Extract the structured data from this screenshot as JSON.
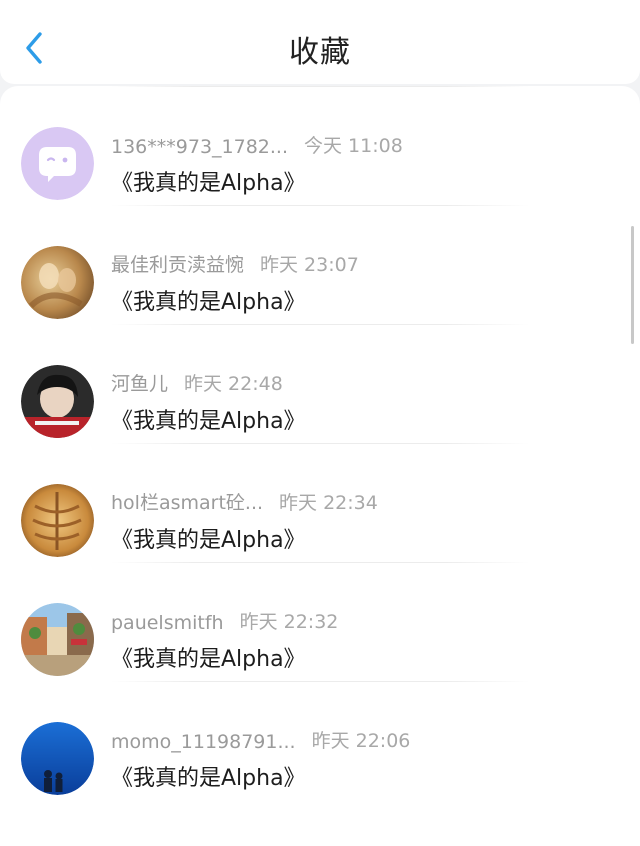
{
  "header": {
    "title": "收藏",
    "back_icon": "chevron-left-icon",
    "accent": "#2d9ce8"
  },
  "items": [
    {
      "name": "136***973_1782...",
      "time": "今天 11:08",
      "content": "《我真的是Alpha》",
      "avatar": "chat-bubble-avatar"
    },
    {
      "name": "最佳利贡渎益惋",
      "time": "昨天 23:07",
      "content": "《我真的是Alpha》",
      "avatar": "photo-avatar"
    },
    {
      "name": "河鱼儿",
      "time": "昨天 22:48",
      "content": "《我真的是Alpha》",
      "avatar": "photo-avatar"
    },
    {
      "name": "hol栏asmart砼...",
      "time": "昨天 22:34",
      "content": "《我真的是Alpha》",
      "avatar": "photo-avatar"
    },
    {
      "name": "pauelsmitfh",
      "time": "昨天 22:32",
      "content": "《我真的是Alpha》",
      "avatar": "photo-avatar"
    },
    {
      "name": "momo_11198791...",
      "time": "昨天 22:06",
      "content": "《我真的是Alpha》",
      "avatar": "photo-avatar"
    }
  ]
}
